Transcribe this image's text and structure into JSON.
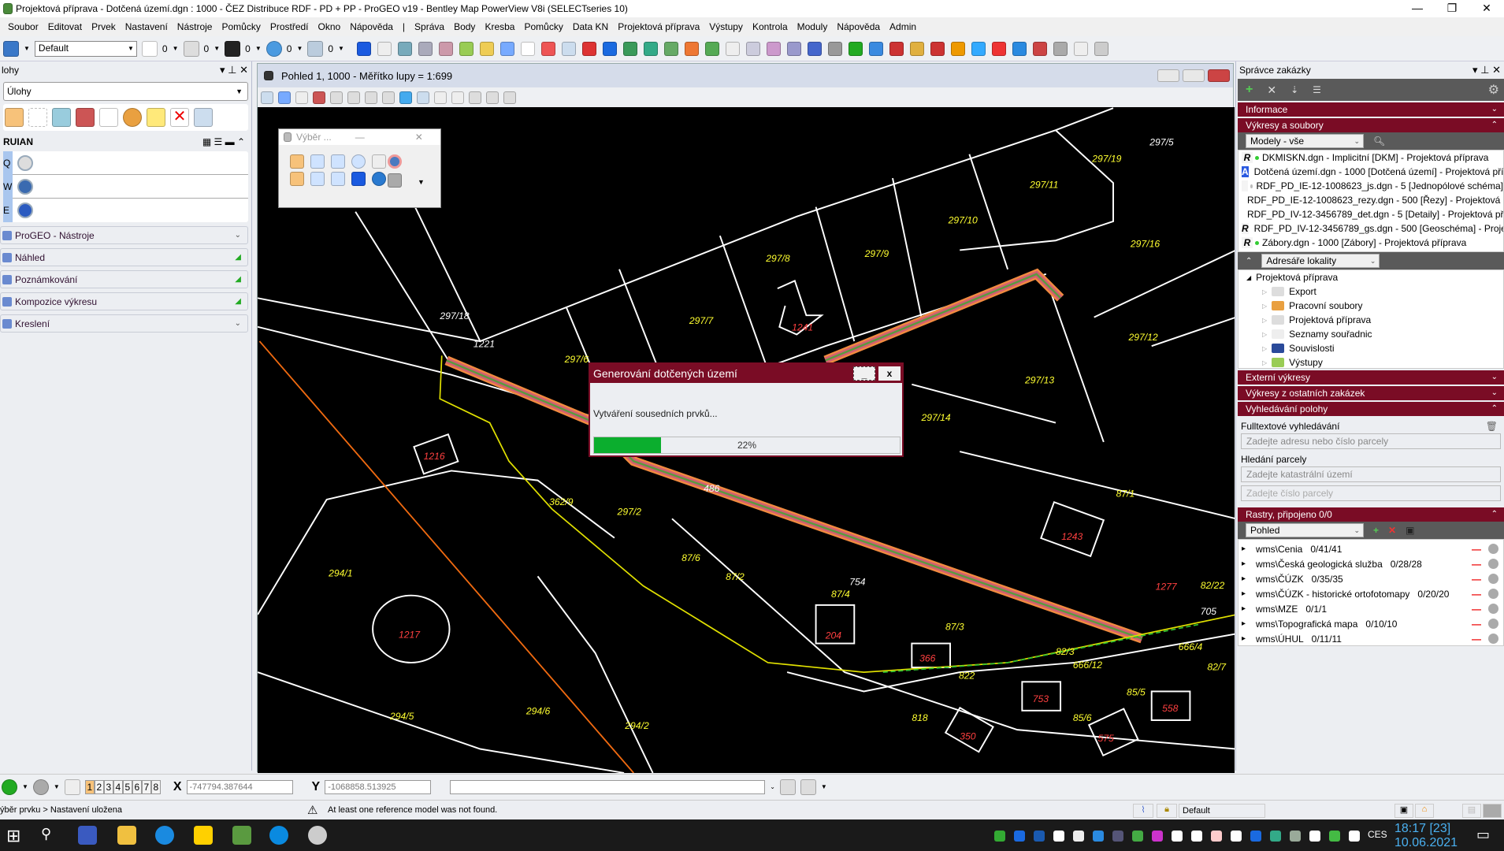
{
  "window": {
    "title": "Projektová příprava - Dotčená území.dgn : 1000 - ČEZ Distribuce RDF - PD + PP - ProGEO v19 - Bentley Map PowerView V8i (SELECTseries 10)",
    "min": "—",
    "max": "❐",
    "close": "✕"
  },
  "menu": [
    "Soubor",
    "Editovat",
    "Prvek",
    "Nastavení",
    "Nástroje",
    "Pomůcky",
    "Prostředí",
    "Okno",
    "Nápověda",
    "|",
    "Správa",
    "Body",
    "Kresba",
    "Pomůcky",
    "Data KN",
    "Projektová příprava",
    "Výstupy",
    "Kontrola",
    "Moduly",
    "Nápověda",
    "Admin"
  ],
  "toolbar": {
    "level": "Default",
    "color": "0",
    "style": "0",
    "weight": "0",
    "transp": "0",
    "prio": "0"
  },
  "left": {
    "title": "lohy",
    "tasks_select": "Úlohy",
    "ruian": "RUIAN",
    "keys": [
      "Q",
      "W",
      "E"
    ],
    "sections": [
      "ProGEO - Nástroje",
      "Náhled",
      "Poznámkování",
      "Kompozice výkresu",
      "Kreslení"
    ]
  },
  "view": {
    "title": "Pohled 1, 1000 - Měřítko lupy = 1:699"
  },
  "vyber": {
    "title": "Výběr ..."
  },
  "map": {
    "labels": [
      "297/18",
      "297/6",
      "297/7",
      "297/8",
      "297/9",
      "297/10",
      "297/11",
      "297/19",
      "297/5",
      "297/16",
      "297/12",
      "297/13",
      "297/14",
      "1216",
      "297/2",
      "87/6",
      "87/2",
      "294/1",
      "1217",
      "294/5",
      "294/6",
      "294/2",
      "87/4",
      "754",
      "204",
      "87/3",
      "366",
      "822",
      "82/3",
      "666/12",
      "666/4",
      "705",
      "87/1",
      "1243",
      "1277",
      "82/22",
      "753",
      "85/5",
      "85/6",
      "575",
      "350",
      "818",
      "558",
      "82/7",
      "1241",
      "486",
      "362/9",
      "1221"
    ]
  },
  "dialog": {
    "title": "Generování dotčených území",
    "message": "Vytváření sousedních prvků...",
    "progress": 22,
    "progress_label": "22%",
    "min": "_",
    "close": "x"
  },
  "right": {
    "title": "Správce zakázky",
    "bands": {
      "info": "Informace",
      "drawings": "Výkresy a soubory",
      "external": "Externí výkresy",
      "other": "Výkresy z ostatních zakázek",
      "search": "Vyhledávání polohy",
      "rasters": "Rastry, připojeno 0/0"
    },
    "models_select": "Modely - vše",
    "files": [
      {
        "badge": "R",
        "name": "DKMISKN.dgn - Implicitní [DKM]  - Projektová příprava"
      },
      {
        "badge": "A",
        "name": "Dotčená území.dgn - 1000 [Dotčená území]  - Projektová příprava"
      },
      {
        "badge": "",
        "name": "RDF_PD_IE-12-1008623_js.dgn - 5 [Jednopólové schéma]"
      },
      {
        "badge": "",
        "name": "RDF_PD_IE-12-1008623_rezy.dgn - 500 [Řezy]  - Projektová příprava"
      },
      {
        "badge": "",
        "name": "RDF_PD_IV-12-3456789_det.dgn - 5 [Detaily]  - Projektová příprava"
      },
      {
        "badge": "R",
        "name": "RDF_PD_IV-12-3456789_gs.dgn - 500 [Geoschéma]  - Projektová příprava"
      },
      {
        "badge": "R",
        "name": "Zábory.dgn - 1000 [Zábory]  - Projektová příprava"
      }
    ],
    "dirs_select": "Adresáře lokality",
    "tree_root": "Projektová příprava",
    "tree": [
      "Export",
      "Pracovní soubory",
      "Projektová příprava",
      "Seznamy souřadnic",
      "Souvislosti",
      "Výstupy"
    ],
    "fulltext_label": "Fulltextové vyhledávání",
    "fulltext_placeholder": "Zadejte adresu nebo číslo parcely",
    "parcel_label": "Hledání parcely",
    "ku_placeholder": "Zadejte katastrální území",
    "parcel_placeholder": "Zadejte číslo parcely",
    "raster_select": "Pohled",
    "rasters": [
      {
        "name": "wms\\Cenia",
        "count": "0/41/41"
      },
      {
        "name": "wms\\Česká geologická služba",
        "count": "0/28/28"
      },
      {
        "name": "wms\\ČÚZK",
        "count": "0/35/35"
      },
      {
        "name": "wms\\ČÚZK - historické ortofotomapy",
        "count": "0/20/20"
      },
      {
        "name": "wms\\MZE",
        "count": "0/1/1"
      },
      {
        "name": "wms\\Topografická mapa",
        "count": "0/10/10"
      },
      {
        "name": "wms\\ÚHUL",
        "count": "0/11/11"
      }
    ]
  },
  "bottom": {
    "views": [
      "1",
      "2",
      "3",
      "4",
      "5",
      "6",
      "7",
      "8"
    ],
    "x_label": "X",
    "x_value": "-747794.387644",
    "y_label": "Y",
    "y_value": "-1068858.513925"
  },
  "status": {
    "left": "ýběr prvku > Nastavení uložena",
    "message": "At least one reference model was not found.",
    "model": "Default"
  },
  "taskbar": {
    "lang": "CES",
    "time": "18:17  [23]",
    "date": "10.06.2021"
  },
  "colors": {
    "accent": "#7a0c25",
    "progress": "#0bae2e"
  }
}
